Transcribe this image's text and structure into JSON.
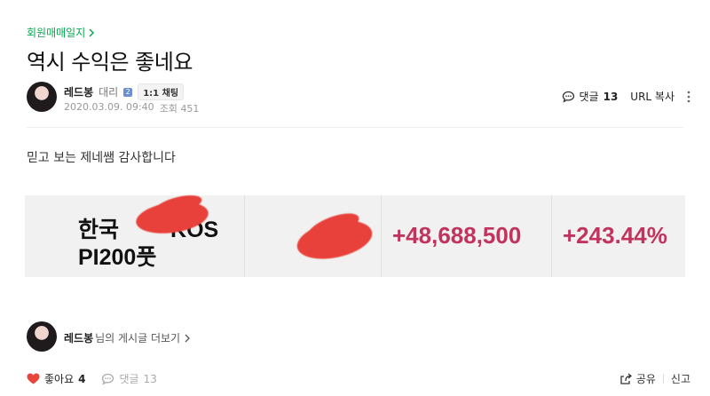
{
  "board": {
    "name": "회원매매일지",
    "chevron": "chevron-right-icon"
  },
  "post": {
    "title": "역시 수익은 좋네요",
    "author": "레드봉",
    "role": "대리",
    "level_badge": "2",
    "chat_label": "1:1 채팅",
    "date": "2020.03.09. 09:40",
    "views_label": "조회",
    "views": "451",
    "body": "믿고 보는 제네쌤 감사합니다"
  },
  "tools": {
    "comment_label": "댓글",
    "comment_count": "13",
    "url_copy": "URL 복사"
  },
  "capture": {
    "name_line1": "한국",
    "name_line1_tail": "KOS",
    "name_line2": "PI200풋",
    "profit": "+48,688,500",
    "rate": "+243.44%"
  },
  "more_posts": {
    "author": "레드봉",
    "label": "님의 게시글 더보기"
  },
  "footer": {
    "like_label": "좋아요",
    "like_count": "4",
    "comment_label": "댓글",
    "comment_count": "13",
    "share_label": "공유",
    "report_label": "신고"
  },
  "colors": {
    "accent_green": "#03a94f",
    "number_pink": "#c2335e",
    "heart_red": "#e8453c",
    "redaction_red": "#e8403a"
  }
}
